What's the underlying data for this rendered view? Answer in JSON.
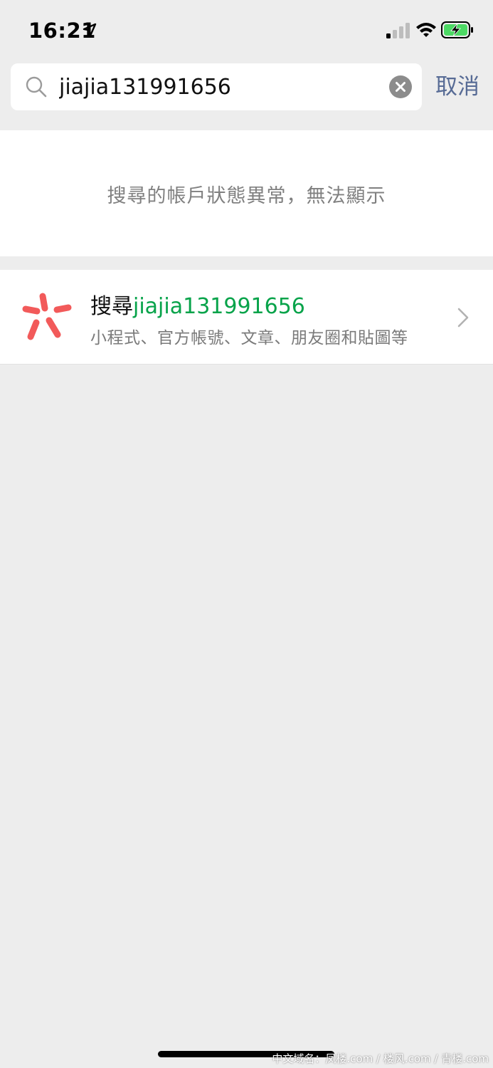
{
  "status_bar": {
    "time": "16:21",
    "location_icon": "location-arrow-icon",
    "signal_icon": "cellular-signal-icon",
    "wifi_icon": "wifi-icon",
    "battery_icon": "battery-charging-icon",
    "battery_color": "#4cd964"
  },
  "search": {
    "value": "jiajia131991656",
    "search_icon": "search-icon",
    "clear_icon": "clear-icon",
    "cancel_label": "取消"
  },
  "notice": {
    "text": "搜尋的帳戶狀態異常，無法顯示"
  },
  "search_row": {
    "icon": "brand-icon",
    "title_prefix": "搜尋",
    "title_query": "jiajia131991656",
    "subtitle": "小程式、官方帳號、文章、朋友圈和貼圖等",
    "chevron_icon": "chevron-right-icon"
  },
  "colors": {
    "accent_link": "#576b95",
    "query_highlight": "#07a34a",
    "brand_red": "#f25a5a",
    "background": "#ededed"
  },
  "watermark": "中文域名：凤楼.com / 楼风.com / 青楼.com"
}
